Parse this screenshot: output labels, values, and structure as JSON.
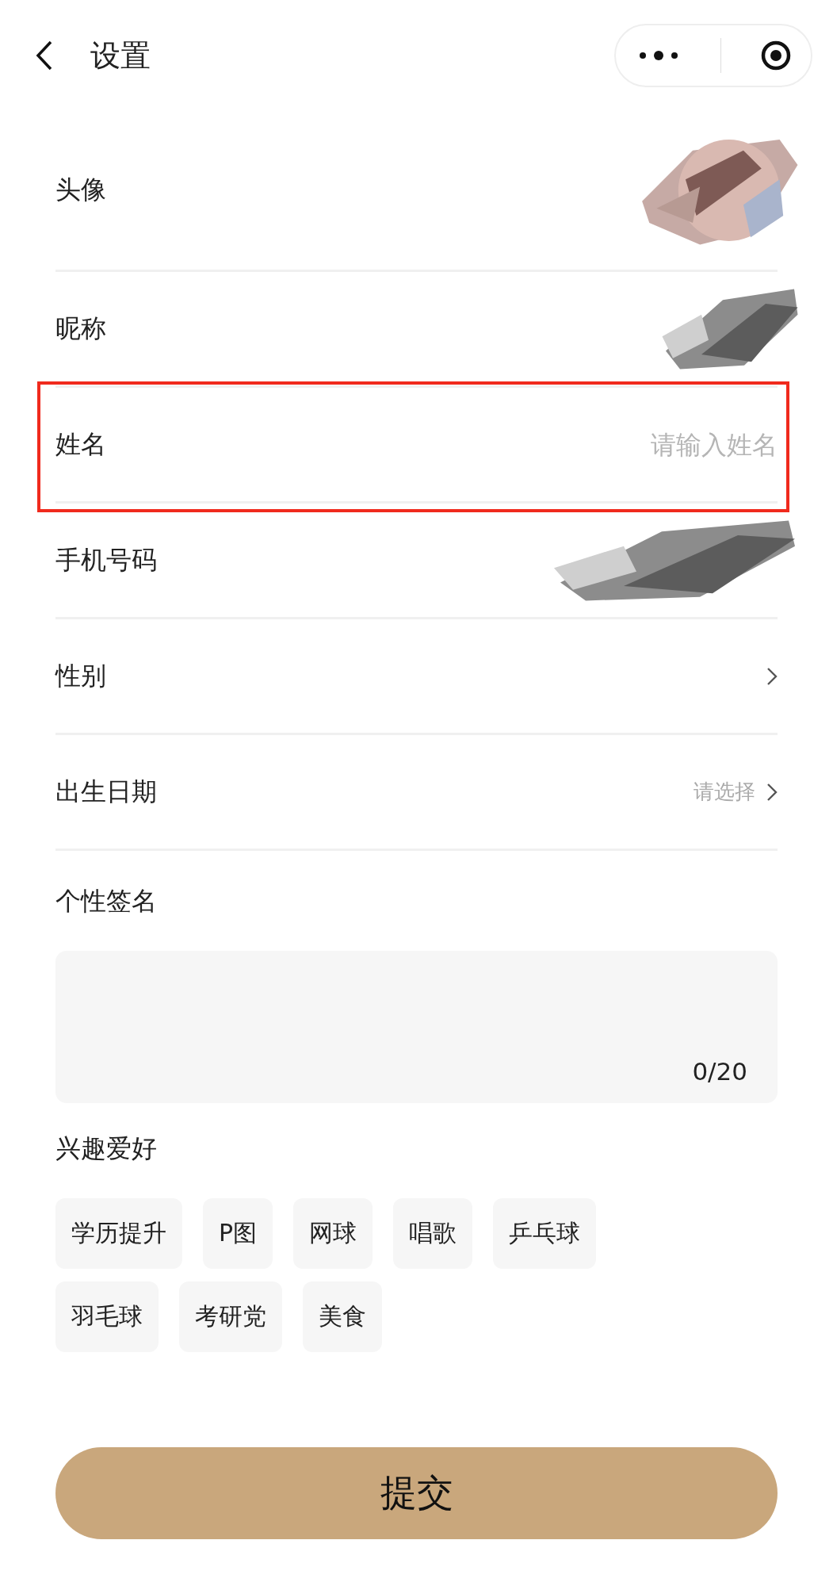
{
  "header": {
    "title": "设置"
  },
  "rows": [
    {
      "kind": "avatar",
      "label": "头像"
    },
    {
      "kind": "redacted",
      "label": "昵称"
    },
    {
      "kind": "input",
      "label": "姓名",
      "placeholder": "请输入姓名",
      "highlighted": true
    },
    {
      "kind": "redacted",
      "label": "手机号码"
    },
    {
      "kind": "select",
      "label": "性别"
    },
    {
      "kind": "select",
      "label": "出生日期",
      "hint": "请选择"
    }
  ],
  "signature": {
    "label": "个性签名",
    "counter": "0/20"
  },
  "hobbies": {
    "label": "兴趣爱好",
    "tags": [
      "学历提升",
      "P图",
      "网球",
      "唱歌",
      "乒乓球",
      "羽毛球",
      "考研党",
      "美食"
    ]
  },
  "submit": "提交"
}
